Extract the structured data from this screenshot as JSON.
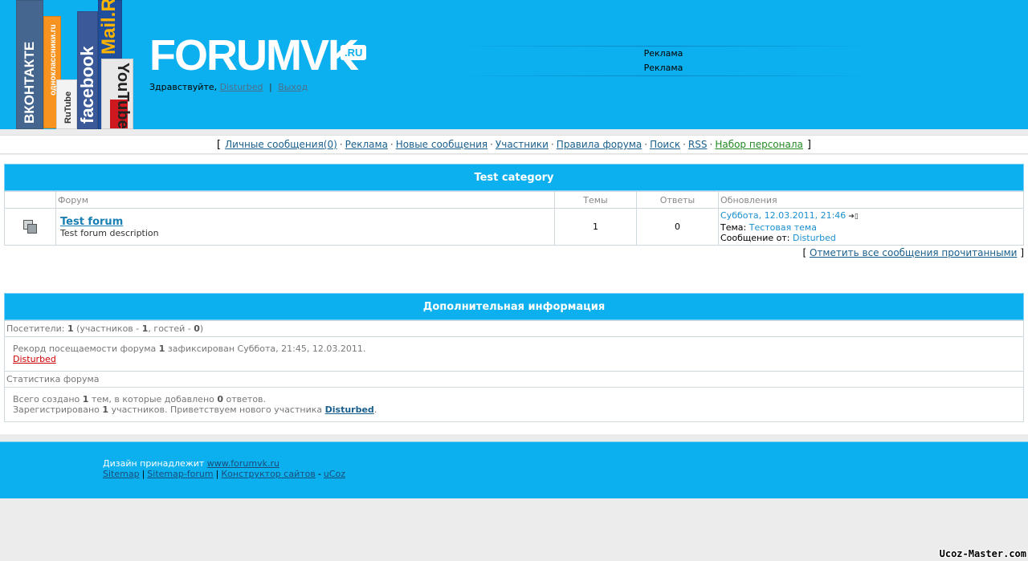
{
  "header": {
    "brand": "FORUMVK",
    "brand_tld": ".RU",
    "badges": {
      "vk": "ВКОНТАКТЕ",
      "ok": "одноклассники.ru",
      "rutube": "RuTube",
      "facebook": "facebook",
      "mail": "Mail.Ru",
      "youtube": "YouTube"
    },
    "greeting_prefix": "Здравствуйте,",
    "username": "Disturbed",
    "separator": "|",
    "logout": "Выход",
    "ads": [
      "Реклама",
      "Реклама"
    ]
  },
  "nav": {
    "open_bracket": "[",
    "close_bracket": "]",
    "dot": "·",
    "items": [
      "Личные сообщения(0)",
      "Реклама",
      "Новые сообщения",
      "Участники",
      "Правила форума",
      "Поиск",
      "RSS",
      "Набор персонала"
    ]
  },
  "forum": {
    "category": "Test category",
    "columns": [
      "Форум",
      "Темы",
      "Ответы",
      "Обновления"
    ],
    "rows": [
      {
        "name": "Test forum",
        "description": "Test forum description",
        "topics": "1",
        "replies": "0",
        "last_date": "Суббота, 12.03.2011, 21:46",
        "topic_label": "Тема:",
        "topic": "Тестовая тема",
        "author_label": "Сообщение от:",
        "author": "Disturbed"
      }
    ],
    "mark_read": "Отметить все сообщения прочитанными"
  },
  "info": {
    "title": "Дополнительная информация",
    "visitors_label": "Посетители:",
    "visitors_total": "1",
    "visitors_members_label": "(участников -",
    "visitors_members": "1",
    "visitors_guests_label": ", гостей -",
    "visitors_guests": "0",
    "visitors_close": ")",
    "record_prefix": "Рекорд посещаемости форума",
    "record_count": "1",
    "record_suffix": "зафиксирован Суббота, 21:45, 12.03.2011.",
    "record_user": "Disturbed",
    "stats_title": "Статистика форума",
    "stats_created_prefix": "Всего создано",
    "stats_topics": "1",
    "stats_created_mid": "тем, в которые добавлено",
    "stats_replies": "0",
    "stats_created_suffix": "ответов.",
    "stats_reg_prefix": "Зарегистрировано",
    "stats_members": "1",
    "stats_reg_mid": "участников. Приветствуем нового участника",
    "stats_newest": "Disturbed",
    "stats_reg_suffix": "."
  },
  "footer": {
    "design_prefix": "Дизайн принадлежит",
    "design_link": "www.forumvk.ru",
    "links": [
      "Sitemap",
      "Sitemap-forum",
      "Конструктор сайтов"
    ],
    "dash": "-",
    "ucoz": "uCoz"
  },
  "watermark": "Ucoz-Master.com",
  "colors": {
    "header_blue": "#0db0ee",
    "link": "#1a5f8c",
    "link_green": "#248a24",
    "link_red": "#cc0000"
  }
}
